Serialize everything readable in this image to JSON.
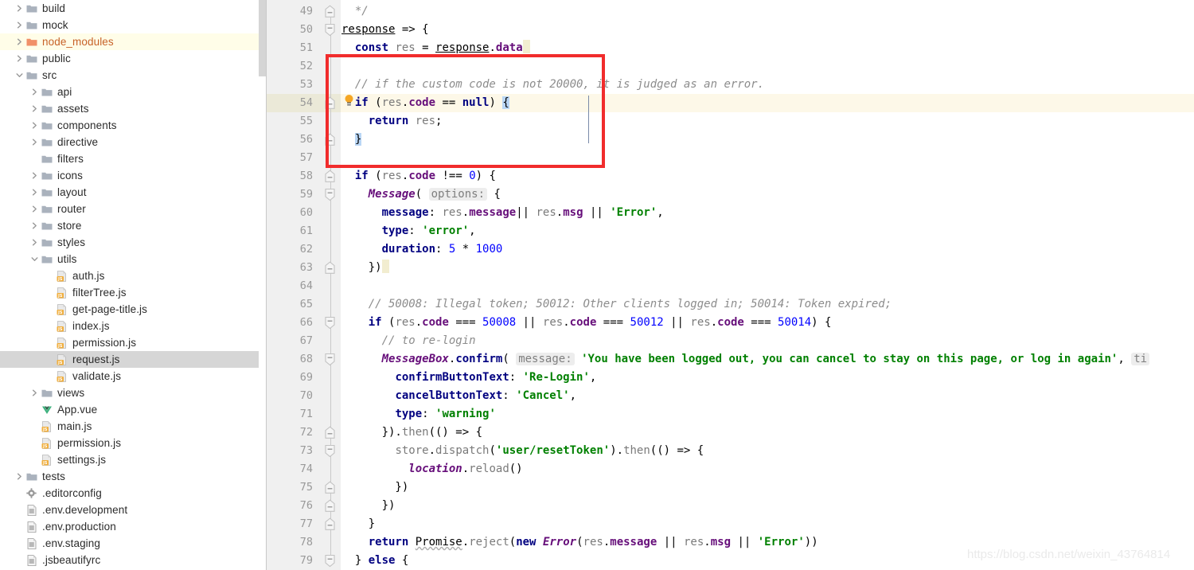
{
  "window": {
    "kind": "ide-screenshot",
    "watermark": "https://blog.csdn.net/weixin_43764814"
  },
  "colors": {
    "selection_row": "#d6d6d6",
    "marked_row": "#fffde8",
    "caret_row": "#fdf8e8",
    "gutter_bg": "#f0f0f0",
    "annotation_box": "#f12c2c",
    "node_modules_label": "#c76228",
    "keyword": "#000080",
    "string": "#008000",
    "number": "#0000ff",
    "comment": "#8c8c8c",
    "field": "#660e7a",
    "brace_match": "#b9d6f5"
  },
  "project_tree": {
    "name": "project-file-tree",
    "selected_file": "request.js",
    "marked_folder": "node_modules",
    "items": [
      {
        "label": "build",
        "indent": 0,
        "type": "folder",
        "arrow": "collapsed"
      },
      {
        "label": "mock",
        "indent": 0,
        "type": "folder",
        "arrow": "collapsed"
      },
      {
        "label": "node_modules",
        "indent": 0,
        "type": "folder-orange",
        "arrow": "collapsed",
        "marked": true
      },
      {
        "label": "public",
        "indent": 0,
        "type": "folder",
        "arrow": "collapsed"
      },
      {
        "label": "src",
        "indent": 0,
        "type": "folder",
        "arrow": "expanded"
      },
      {
        "label": "api",
        "indent": 1,
        "type": "folder",
        "arrow": "collapsed"
      },
      {
        "label": "assets",
        "indent": 1,
        "type": "folder",
        "arrow": "collapsed"
      },
      {
        "label": "components",
        "indent": 1,
        "type": "folder",
        "arrow": "collapsed"
      },
      {
        "label": "directive",
        "indent": 1,
        "type": "folder",
        "arrow": "collapsed"
      },
      {
        "label": "filters",
        "indent": 1,
        "type": "folder",
        "arrow": "none"
      },
      {
        "label": "icons",
        "indent": 1,
        "type": "folder",
        "arrow": "collapsed"
      },
      {
        "label": "layout",
        "indent": 1,
        "type": "folder",
        "arrow": "collapsed"
      },
      {
        "label": "router",
        "indent": 1,
        "type": "folder",
        "arrow": "collapsed"
      },
      {
        "label": "store",
        "indent": 1,
        "type": "folder",
        "arrow": "collapsed"
      },
      {
        "label": "styles",
        "indent": 1,
        "type": "folder",
        "arrow": "collapsed"
      },
      {
        "label": "utils",
        "indent": 1,
        "type": "folder",
        "arrow": "expanded"
      },
      {
        "label": "auth.js",
        "indent": 2,
        "type": "js",
        "arrow": "none"
      },
      {
        "label": "filterTree.js",
        "indent": 2,
        "type": "js",
        "arrow": "none"
      },
      {
        "label": "get-page-title.js",
        "indent": 2,
        "type": "js",
        "arrow": "none"
      },
      {
        "label": "index.js",
        "indent": 2,
        "type": "js",
        "arrow": "none"
      },
      {
        "label": "permission.js",
        "indent": 2,
        "type": "js",
        "arrow": "none"
      },
      {
        "label": "request.js",
        "indent": 2,
        "type": "js",
        "arrow": "none",
        "selected": true
      },
      {
        "label": "validate.js",
        "indent": 2,
        "type": "js",
        "arrow": "none"
      },
      {
        "label": "views",
        "indent": 1,
        "type": "folder",
        "arrow": "collapsed"
      },
      {
        "label": "App.vue",
        "indent": 1,
        "type": "vue",
        "arrow": "none"
      },
      {
        "label": "main.js",
        "indent": 1,
        "type": "js",
        "arrow": "none"
      },
      {
        "label": "permission.js",
        "indent": 1,
        "type": "js",
        "arrow": "none"
      },
      {
        "label": "settings.js",
        "indent": 1,
        "type": "js",
        "arrow": "none"
      },
      {
        "label": "tests",
        "indent": 0,
        "type": "folder",
        "arrow": "collapsed"
      },
      {
        "label": ".editorconfig",
        "indent": 0,
        "type": "config",
        "arrow": "none"
      },
      {
        "label": ".env.development",
        "indent": 0,
        "type": "text",
        "arrow": "none"
      },
      {
        "label": ".env.production",
        "indent": 0,
        "type": "text",
        "arrow": "none"
      },
      {
        "label": ".env.staging",
        "indent": 0,
        "type": "text",
        "arrow": "none"
      },
      {
        "label": ".jsbeautifyrc",
        "indent": 0,
        "type": "text",
        "arrow": "none"
      }
    ]
  },
  "editor": {
    "name": "code-editor",
    "language": "javascript",
    "first_line_number": 49,
    "last_line_number": 79,
    "caret_line": 54,
    "annotation_box": {
      "lines": "52-57",
      "color": "#f12c2c"
    },
    "intention_bulb_line": 54,
    "lines": [
      {
        "n": 49,
        "text": "  */"
      },
      {
        "n": 50,
        "text": "response => {"
      },
      {
        "n": 51,
        "text": "  const res = response.data"
      },
      {
        "n": 52,
        "text": ""
      },
      {
        "n": 53,
        "text": "  // if the custom code is not 20000, it is judged as an error."
      },
      {
        "n": 54,
        "text": "  if (res.code == null) {"
      },
      {
        "n": 55,
        "text": "    return res;"
      },
      {
        "n": 56,
        "text": "  }"
      },
      {
        "n": 57,
        "text": ""
      },
      {
        "n": 58,
        "text": "  if (res.code !== 0) {"
      },
      {
        "n": 59,
        "text": "    Message( options: {"
      },
      {
        "n": 60,
        "text": "      message: res.message|| res.msg || 'Error',"
      },
      {
        "n": 61,
        "text": "      type: 'error',"
      },
      {
        "n": 62,
        "text": "      duration: 5 * 1000"
      },
      {
        "n": 63,
        "text": "    })"
      },
      {
        "n": 64,
        "text": ""
      },
      {
        "n": 65,
        "text": "    // 50008: Illegal token; 50012: Other clients logged in; 50014: Token expired;"
      },
      {
        "n": 66,
        "text": "    if (res.code === 50008 || res.code === 50012 || res.code === 50014) {"
      },
      {
        "n": 67,
        "text": "      // to re-login"
      },
      {
        "n": 68,
        "text": "      MessageBox.confirm( message: 'You have been logged out, you can cancel to stay on this page, or log in again', ti"
      },
      {
        "n": 69,
        "text": "        confirmButtonText: 'Re-Login',"
      },
      {
        "n": 70,
        "text": "        cancelButtonText: 'Cancel',"
      },
      {
        "n": 71,
        "text": "        type: 'warning'"
      },
      {
        "n": 72,
        "text": "      }).then(() => {"
      },
      {
        "n": 73,
        "text": "        store.dispatch('user/resetToken').then(() => {"
      },
      {
        "n": 74,
        "text": "          location.reload()"
      },
      {
        "n": 75,
        "text": "        })"
      },
      {
        "n": 76,
        "text": "      })"
      },
      {
        "n": 77,
        "text": "    }"
      },
      {
        "n": 78,
        "text": "    return Promise.reject(new Error(res.message || res.msg || 'Error'))"
      },
      {
        "n": 79,
        "text": "  } else {"
      }
    ],
    "inlay_hints": [
      "options:",
      "message:",
      "ti"
    ],
    "fold_markers": {
      "collapse_start": [
        50,
        59,
        66,
        68,
        73,
        79
      ],
      "collapse_end": [
        49,
        54,
        56,
        58,
        63,
        72,
        75,
        76,
        77
      ]
    }
  }
}
